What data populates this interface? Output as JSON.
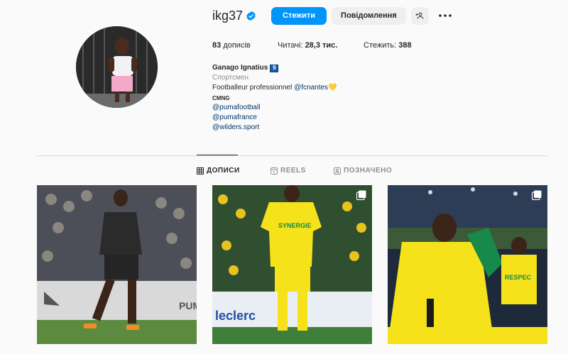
{
  "profile": {
    "username": "ikg37",
    "verified_icon": "verified-badge-icon",
    "follow_label": "Стежити",
    "message_label": "Повідомлення",
    "add_user_icon": "add-user-icon",
    "more_icon": "more-options-icon"
  },
  "stats": {
    "posts_count": "83",
    "posts_label": "дописів",
    "followers_label": "Читачі:",
    "followers_count": "28,3 тис.",
    "following_label": "Стежить:",
    "following_count": "388"
  },
  "bio": {
    "name": "Ganago Ignatius",
    "badge": "9",
    "category": "Спортсмен",
    "line1_prefix": "Footballeur professionnel ",
    "line1_mention": "@fcnantes",
    "line1_emoji": "💛",
    "line2": "CMNG",
    "handles": [
      "@pumafootball",
      "@pumafrance",
      "@wilders.sport"
    ]
  },
  "tabs": [
    {
      "label": "ДОПИСИ",
      "icon": "grid-icon",
      "active": true
    },
    {
      "label": "REELS",
      "icon": "reels-icon",
      "active": false
    },
    {
      "label": "ПОЗНАЧЕНО",
      "icon": "tagged-icon",
      "active": false
    }
  ],
  "posts": [
    {
      "kind": "single",
      "sign_text": "PUMA"
    },
    {
      "kind": "carousel",
      "jersey_text": "SYNERGIE",
      "sign_text": "leclerc"
    },
    {
      "kind": "carousel",
      "sign_text": "RESPEC"
    }
  ],
  "colors": {
    "accent": "#0095f6",
    "link": "#00376b",
    "nantes_yellow": "#f5e21b",
    "nantes_green": "#16894b"
  }
}
